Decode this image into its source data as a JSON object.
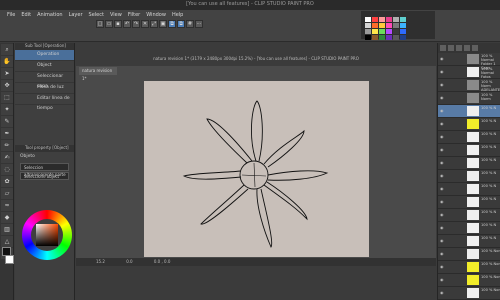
{
  "window": {
    "title": "[You can use all features] - CLIP STUDIO PAINT PRO"
  },
  "menu": {
    "items": [
      "File",
      "Edit",
      "Animation",
      "Layer",
      "Select",
      "View",
      "Filter",
      "Window",
      "Help"
    ]
  },
  "canvas_title": "natura revision 1* (3179 x 2480px 300dpi 15.2%) - [You can use all features] - CLIP STUDIO PAINT PRO",
  "subtool": {
    "header": "Sub Tool [Operation]",
    "items": [
      {
        "label": "Operation",
        "selected": true
      },
      {
        "label": "Object",
        "selected": false
      },
      {
        "label": "Seleccionar capa",
        "selected": false
      },
      {
        "label": "Mesa de luz",
        "selected": false
      },
      {
        "label": "Editar línea de tiempo",
        "selected": false
      }
    ],
    "property_header": "Tool property [Object]",
    "object_label": "Objeto",
    "dropdown1": "Seleccion a/transparente parte",
    "dropdown2": "Seleccione object"
  },
  "document_tab": "natura revision 1*",
  "status": {
    "zoom": "15.2",
    "angle": "0.0",
    "coords": "0.0 , 0.0"
  },
  "layers": [
    {
      "name": "100 % Normal Folder 1 Copy",
      "kind": "folder",
      "selected": false
    },
    {
      "name": "100 % Normal Fotos",
      "kind": "normal",
      "selected": false
    },
    {
      "name": "100 % Norm ADELANTE",
      "kind": "folder",
      "selected": false
    },
    {
      "name": "100 % Norm",
      "kind": "folder",
      "selected": false
    },
    {
      "name": "100 % N",
      "kind": "normal",
      "selected": true
    },
    {
      "name": "100 % N",
      "kind": "yellow",
      "selected": false
    },
    {
      "name": "100 % N",
      "kind": "normal",
      "selected": false
    },
    {
      "name": "100 % N",
      "kind": "normal",
      "selected": false
    },
    {
      "name": "100 % N",
      "kind": "normal",
      "selected": false
    },
    {
      "name": "100 % N",
      "kind": "normal",
      "selected": false
    },
    {
      "name": "100 % N",
      "kind": "normal",
      "selected": false
    },
    {
      "name": "100 % N",
      "kind": "normal",
      "selected": false
    },
    {
      "name": "100 % N",
      "kind": "normal",
      "selected": false
    },
    {
      "name": "100 % N",
      "kind": "normal",
      "selected": false
    },
    {
      "name": "100 % N",
      "kind": "normal",
      "selected": false
    },
    {
      "name": "100 % Nor",
      "kind": "normal",
      "selected": false
    },
    {
      "name": "100 % Nor",
      "kind": "yellow",
      "selected": false
    },
    {
      "name": "100 % Nor",
      "kind": "yellow",
      "selected": false
    },
    {
      "name": "100 % Nor",
      "kind": "normal",
      "selected": false
    }
  ],
  "colors": {
    "accent": "#4e7fb8",
    "paper": "#c8bfb9",
    "stroke": "#111111"
  }
}
